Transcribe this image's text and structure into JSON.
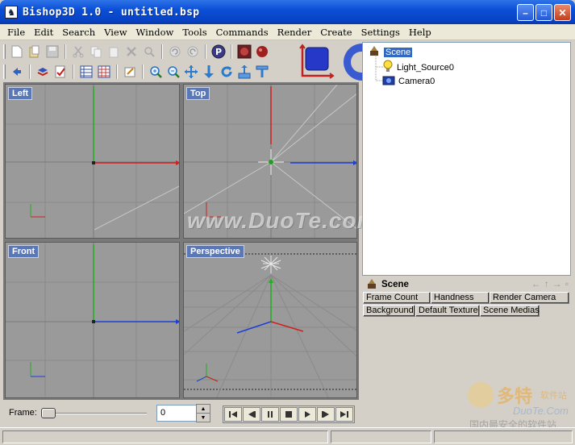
{
  "window": {
    "title": "Bishop3D 1.0 - untitled.bsp",
    "icon_glyph": "♞",
    "minimize": "–",
    "maximize": "□",
    "close": "✕"
  },
  "menu": [
    "File",
    "Edit",
    "Search",
    "View",
    "Window",
    "Tools",
    "Commands",
    "Render",
    "Create",
    "Settings",
    "Help"
  ],
  "toolbar1_icons": [
    "new-file-icon",
    "open-folder-icon",
    "save-icon",
    "cut-icon",
    "copy-icon",
    "paste-icon",
    "delete-icon",
    "find-icon",
    "undo-icon",
    "redo-icon",
    "help-icon",
    "render-icon",
    "render-preview-icon"
  ],
  "toolbar2_icons": [
    "back-icon",
    "layers-icon",
    "properties-icon",
    "grid-view-icon",
    "table-view-icon",
    "edit-icon",
    "zoom-in-icon",
    "zoom-out-icon",
    "move-icon",
    "move-down-icon",
    "rotate-icon",
    "scale-icon",
    "align-icon"
  ],
  "viewports": {
    "left": "Left",
    "top": "Top",
    "front": "Front",
    "perspective": "Perspective"
  },
  "tree": {
    "root": "Scene",
    "children": [
      "Light_Source0",
      "Camera0"
    ]
  },
  "properties": {
    "title": "Scene",
    "nav": [
      "←",
      "↑",
      "→",
      "▫"
    ],
    "tabs_row1": [
      "Frame Count",
      "Handness",
      "Render Camera"
    ],
    "tabs_row2": [
      "Background",
      "Default Texture",
      "Scene Medias"
    ]
  },
  "frame": {
    "label": "Frame:",
    "value": "0",
    "spin_up": "▲",
    "spin_down": "▼"
  },
  "playback_icons": [
    "first-frame-icon",
    "prev-frame-icon",
    "pause-icon",
    "stop-icon",
    "play-icon",
    "next-frame-icon",
    "last-frame-icon"
  ],
  "watermark": {
    "text": "www.DuoTe.com",
    "logo_main": "多特",
    "logo_small": "软件站",
    "logo_url": "DuoTe.Com",
    "logo_sub": "国内最安全的软件站"
  },
  "colors": {
    "axis_x": "#d02020",
    "axis_y": "#20b020",
    "axis_z": "#2040d0",
    "viewport_bg": "#9a9a9a",
    "selection": "#316ac5"
  }
}
